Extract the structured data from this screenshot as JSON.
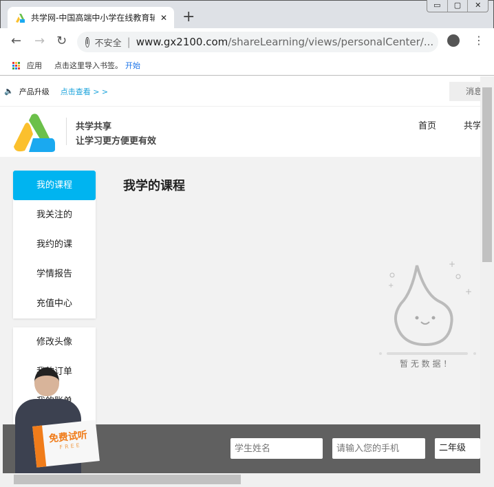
{
  "browser": {
    "tab_title": "共学网-中国高端中小学在线教育辅导",
    "url_insecure_label": "不安全",
    "url_host": "www.gx2100.com",
    "url_path": "/shareLearning/views/personalCenter/...",
    "bookmarks": {
      "apps": "应用",
      "import_text": "点击这里导入书签。",
      "start_link": "开始"
    }
  },
  "notice": {
    "label": "产品升级",
    "link": "点击查看 > >",
    "message_button": "消息"
  },
  "header": {
    "brand_line1": "共学共享",
    "brand_line2": "让学习更方便更有效",
    "nav": [
      "首页",
      "共学"
    ]
  },
  "sidebar": {
    "group1": [
      "我的课程",
      "我关注的",
      "我约的课",
      "学情报告",
      "充值中心"
    ],
    "group2": [
      "修改头像",
      "我的订单",
      "我的账单"
    ]
  },
  "main": {
    "title": "我学的课程",
    "empty_text": "暂 无 数 据 ！"
  },
  "footer": {
    "promo_text": "免费试听",
    "promo_sub": "FREE",
    "name_placeholder": "学生姓名",
    "phone_placeholder": "请输入您的手机",
    "grade_value": "二年级"
  },
  "colors": {
    "accent": "#00b4f0",
    "footer_bg": "#606060",
    "content_bg": "#f2f2f2"
  }
}
